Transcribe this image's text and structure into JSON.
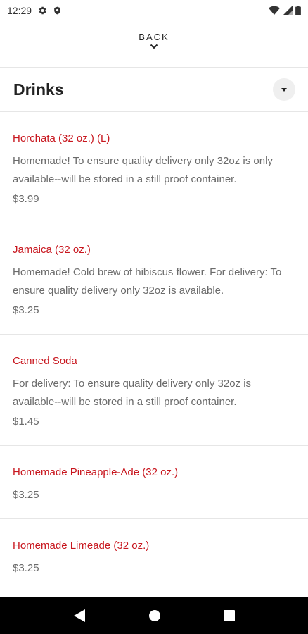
{
  "status_bar": {
    "time": "12:29"
  },
  "back": {
    "label": "BACK"
  },
  "category": {
    "title": "Drinks"
  },
  "items": [
    {
      "name": "Horchata (32 oz.) (L)",
      "description": "Homemade! To ensure quality delivery only 32oz is only available--will be stored in a still proof container.",
      "price": "$3.99"
    },
    {
      "name": "Jamaica (32 oz.)",
      "description": "Homemade! Cold brew of hibiscus flower. For delivery: To ensure quality delivery only 32oz is available.",
      "price": "$3.25"
    },
    {
      "name": "Canned Soda",
      "description": "For delivery: To ensure quality delivery only 32oz is available--will be stored in a still proof container.",
      "price": "$1.45"
    },
    {
      "name": "Homemade Pineapple-Ade (32 oz.)",
      "description": "",
      "price": "$3.25"
    },
    {
      "name": "Homemade Limeade (32 oz.)",
      "description": "",
      "price": "$3.25"
    }
  ],
  "icons": {
    "settings": "gear-icon",
    "shield": "shield-icon",
    "wifi": "wifi-icon",
    "signal": "signal-icon",
    "battery": "battery-icon",
    "back_chevron": "chevron-down-icon",
    "dropdown": "caret-down-icon",
    "nav_back": "nav-back-icon",
    "nav_home": "nav-home-icon",
    "nav_recents": "nav-recents-icon"
  },
  "colors": {
    "accent": "#c8161e",
    "text_secondary": "#6b6b6b",
    "nav_bar": "#000000"
  }
}
